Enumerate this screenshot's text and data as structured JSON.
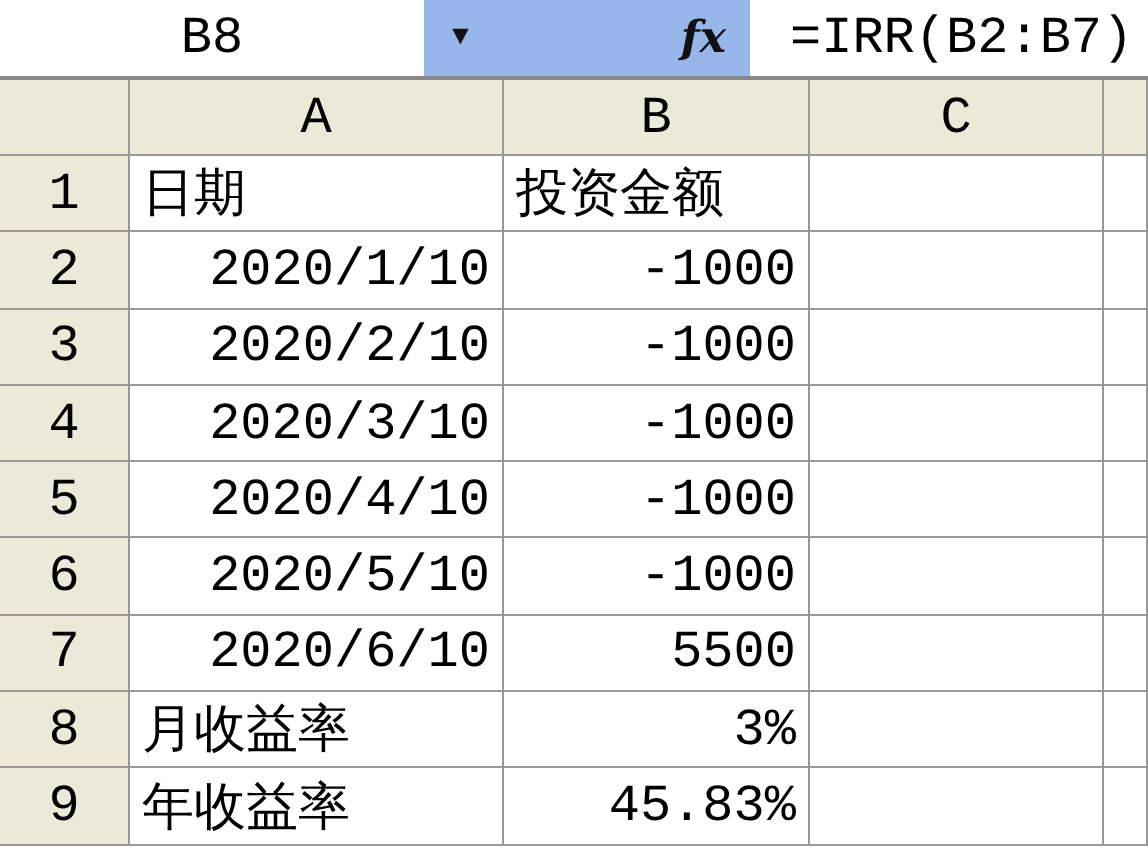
{
  "formula_bar": {
    "name_box": "B8",
    "dropdown": "▼",
    "fx_label": "fx",
    "formula": "=IRR(B2:B7)"
  },
  "sheet": {
    "columns": [
      "A",
      "B",
      "C"
    ],
    "rows": [
      {
        "number": "1",
        "cells": [
          {
            "text": "日期",
            "kind": "text"
          },
          {
            "text": "投资金额",
            "kind": "text"
          }
        ]
      },
      {
        "number": "2",
        "cells": [
          {
            "text": "2020/1/10",
            "kind": "number"
          },
          {
            "text": "-1000",
            "kind": "number"
          }
        ]
      },
      {
        "number": "3",
        "cells": [
          {
            "text": "2020/2/10",
            "kind": "number"
          },
          {
            "text": "-1000",
            "kind": "number"
          }
        ]
      },
      {
        "number": "4",
        "cells": [
          {
            "text": "2020/3/10",
            "kind": "number"
          },
          {
            "text": "-1000",
            "kind": "number"
          }
        ]
      },
      {
        "number": "5",
        "cells": [
          {
            "text": "2020/4/10",
            "kind": "number"
          },
          {
            "text": "-1000",
            "kind": "number"
          }
        ]
      },
      {
        "number": "6",
        "cells": [
          {
            "text": "2020/5/10",
            "kind": "number"
          },
          {
            "text": "-1000",
            "kind": "number"
          }
        ]
      },
      {
        "number": "7",
        "cells": [
          {
            "text": "2020/6/10",
            "kind": "number"
          },
          {
            "text": "5500",
            "kind": "number"
          }
        ]
      },
      {
        "number": "8",
        "cells": [
          {
            "text": "月收益率",
            "kind": "text"
          },
          {
            "text": "3%",
            "kind": "number"
          }
        ]
      },
      {
        "number": "9",
        "cells": [
          {
            "text": "年收益率",
            "kind": "text"
          },
          {
            "text": "45.83%",
            "kind": "number"
          }
        ]
      }
    ]
  }
}
